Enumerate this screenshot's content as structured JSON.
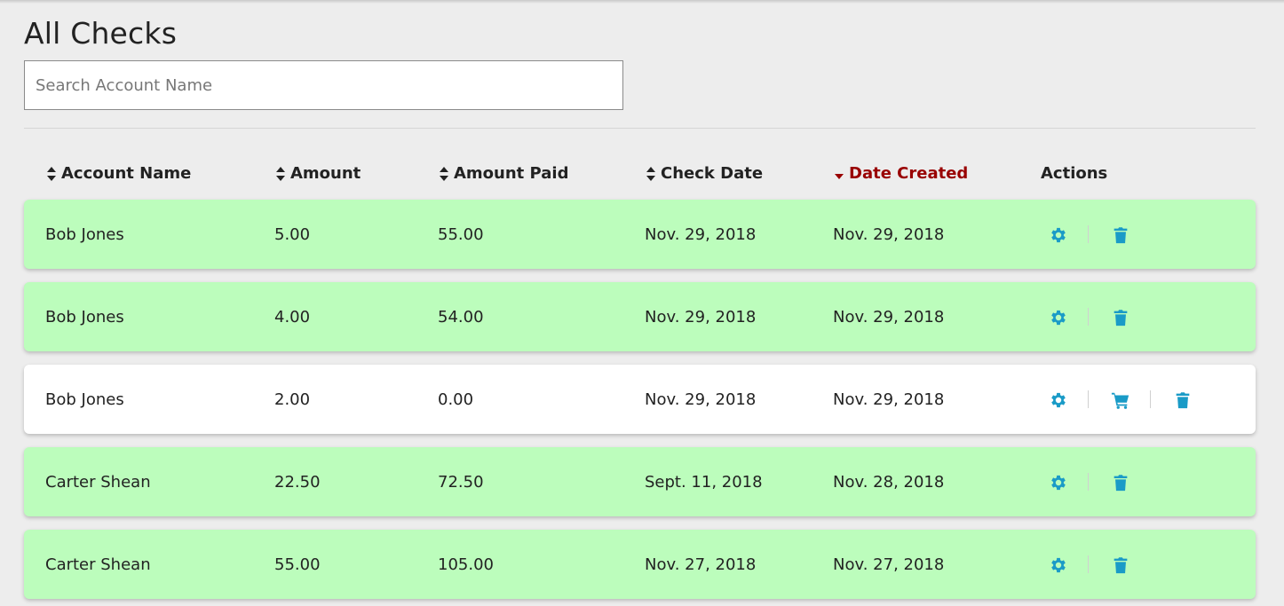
{
  "page": {
    "title": "All Checks"
  },
  "search": {
    "placeholder": "Search Account Name",
    "value": ""
  },
  "table": {
    "columns": [
      {
        "label": "Account Name",
        "sort": "none"
      },
      {
        "label": "Amount",
        "sort": "none"
      },
      {
        "label": "Amount Paid",
        "sort": "none"
      },
      {
        "label": "Check Date",
        "sort": "none"
      },
      {
        "label": "Date Created",
        "sort": "descending"
      },
      {
        "label": "Actions",
        "sort": null
      }
    ],
    "rows": [
      {
        "account": "Bob Jones",
        "amount": "5.00",
        "amount_paid": "55.00",
        "check_date": "Nov. 29, 2018",
        "date_created": "Nov. 29, 2018",
        "status": "paid",
        "actions": [
          "gear-icon",
          "trash-icon"
        ]
      },
      {
        "account": "Bob Jones",
        "amount": "4.00",
        "amount_paid": "54.00",
        "check_date": "Nov. 29, 2018",
        "date_created": "Nov. 29, 2018",
        "status": "paid",
        "actions": [
          "gear-icon",
          "trash-icon"
        ]
      },
      {
        "account": "Bob Jones",
        "amount": "2.00",
        "amount_paid": "0.00",
        "check_date": "Nov. 29, 2018",
        "date_created": "Nov. 29, 2018",
        "status": "unpaid",
        "actions": [
          "gear-icon",
          "cart-icon",
          "trash-icon"
        ]
      },
      {
        "account": "Carter Shean",
        "amount": "22.50",
        "amount_paid": "72.50",
        "check_date": "Sept. 11, 2018",
        "date_created": "Nov. 28, 2018",
        "status": "paid",
        "actions": [
          "gear-icon",
          "trash-icon"
        ]
      },
      {
        "account": "Carter Shean",
        "amount": "55.00",
        "amount_paid": "105.00",
        "check_date": "Nov. 27, 2018",
        "date_created": "Nov. 27, 2018",
        "status": "paid",
        "actions": [
          "gear-icon",
          "trash-icon"
        ]
      }
    ]
  },
  "colors": {
    "paid_row": "#bcfdbc",
    "unpaid_row": "#ffffff",
    "action_icon": "#1a9bc7",
    "active_sort": "#990000",
    "background": "#ededed"
  }
}
